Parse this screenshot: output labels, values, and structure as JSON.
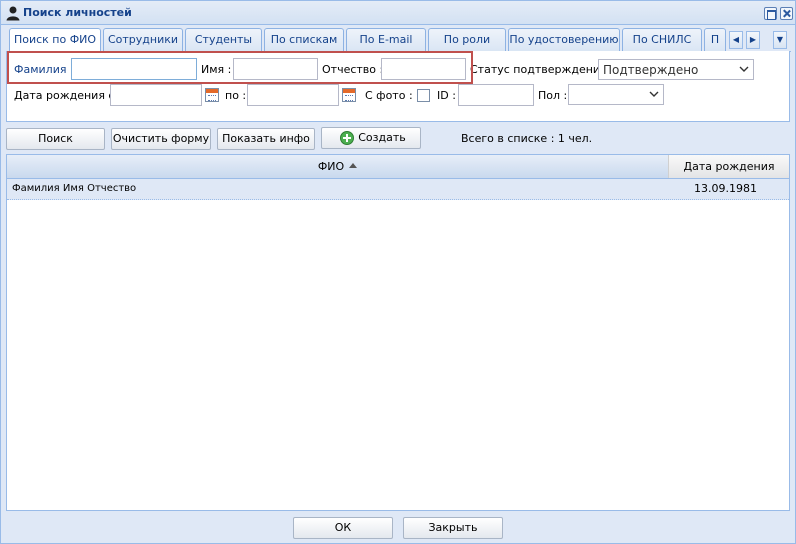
{
  "window": {
    "title": "Поиск личностей"
  },
  "tabs": [
    {
      "label": "Поиск по ФИО",
      "active": true
    },
    {
      "label": "Сотрудники"
    },
    {
      "label": "Студенты"
    },
    {
      "label": "По спискам"
    },
    {
      "label": "По E-mail"
    },
    {
      "label": "По роли"
    },
    {
      "label": "По удостоверению"
    },
    {
      "label": "По СНИЛС"
    },
    {
      "label": "П"
    }
  ],
  "form": {
    "surname_label": "Фамилия :",
    "surname_value": "",
    "name_label": "Имя :",
    "name_value": "",
    "patronymic_label": "Отчество :",
    "patronymic_value": "",
    "status_label": "Статус подтверждения :",
    "status_value": "Подтверждено",
    "birth_from_label": "Дата рождения с :",
    "birth_to_label": "по :",
    "photo_label": "С фото :",
    "id_label": "ID :",
    "gender_label": "Пол :",
    "gender_value": ""
  },
  "toolbar": {
    "search_label": "Поиск",
    "clear_label": "Очистить форму",
    "info_label": "Показать инфо",
    "create_label": "Создать",
    "count_text": "Всего в списке : 1 чел."
  },
  "grid": {
    "columns": {
      "fio": "ФИО",
      "birth_date": "Дата рождения"
    },
    "rows": [
      {
        "fio": "Фамилия Имя Отчество",
        "birth_date": "13.09.1981"
      }
    ]
  },
  "footer": {
    "ok_label": "ОК",
    "close_label": "Закрыть"
  },
  "colors": {
    "accent": "#15428b",
    "border": "#99bbe8",
    "highlight": "#c0504d"
  }
}
